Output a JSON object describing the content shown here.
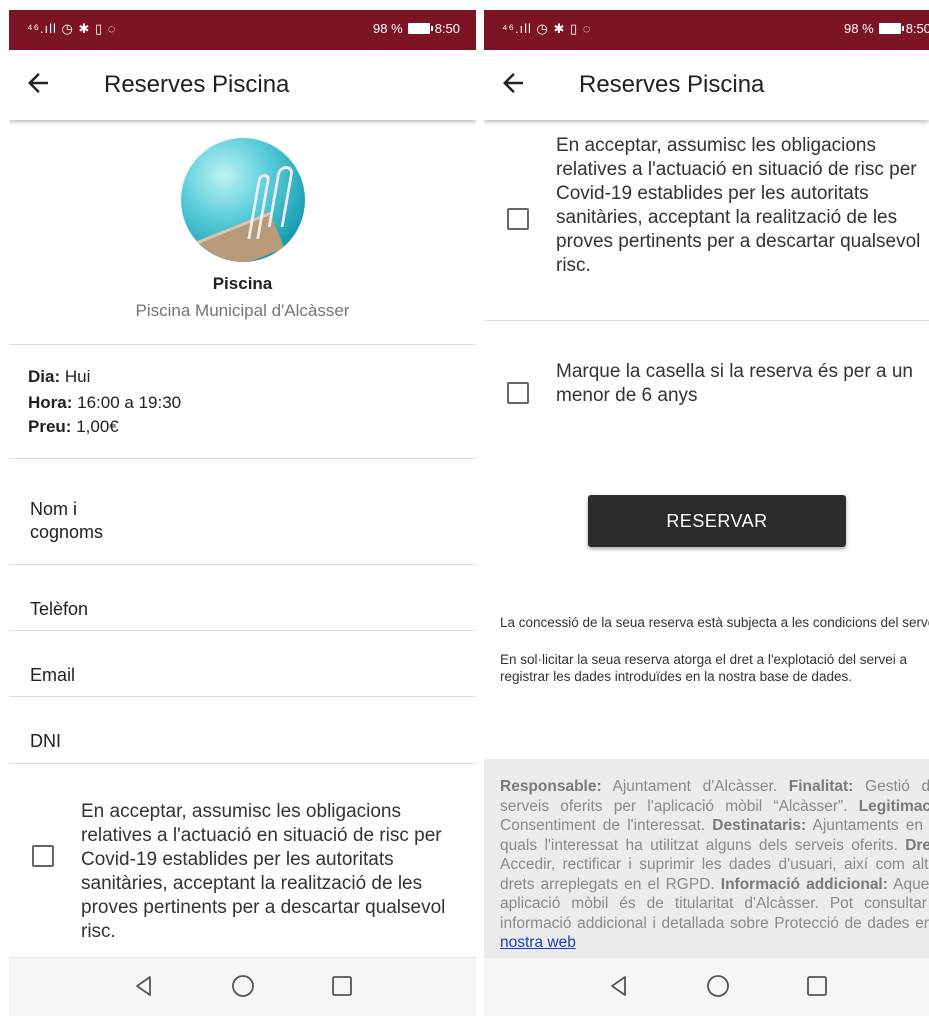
{
  "colors": {
    "status_bar": "#7d1423",
    "button": "#2b2b2b",
    "link": "#1a3fbf"
  },
  "status_bar": {
    "icons_left": "⁴⁶.ıll ◷ ✱ ▯ ◌",
    "battery": "98 %",
    "time": "8:50"
  },
  "app_bar": {
    "back_icon": "arrow-left-icon",
    "title": "Reserves Piscina"
  },
  "left_screen": {
    "facility": {
      "title": "Piscina",
      "subtitle": "Piscina Municipal d'Alcàsser"
    },
    "info": {
      "day_label": "Dia:",
      "day_value": "Hui",
      "hour_label": "Hora:",
      "hour_value": "16:00 a 19:30",
      "price_label": "Preu:",
      "price_value": "1,00€"
    },
    "fields": {
      "name_line1": "Nom i",
      "name_line2": "cognoms",
      "phone": "Telèfon",
      "email": "Email",
      "dni": "DNI"
    },
    "consent_covid": "En acceptar, assumisc les obligacions relatives a l'actuació en situació de risc per Covid-19 establides per les autoritats sanitàries, acceptant la realització de les proves pertinents per a descartar qualsevol risc."
  },
  "right_screen": {
    "consent_covid": "En acceptar, assumisc les obligacions relatives a l'actuació en situació de risc per Covid-19 establides per les autoritats sanitàries, acceptant la realització de les proves pertinents per a descartar qualsevol risc.",
    "consent_minor": "Marque la casella si la reserva és per a un menor de 6 anys",
    "reserve_button": "RESERVAR",
    "note_conditions": "La concessió de la seua reserva està subjecta a les condicions del servei.",
    "note_data": "En sol·licitar la seua reserva atorga el dret a l'explotació del servei a registrar les dades introduïdes en la nostra base de dades.",
    "legal": {
      "responsable_label": "Responsable:",
      "responsable_text": " Ajuntament d'Alcàsser. ",
      "finalitat_label": "Finalitat:",
      "finalitat_text": " Gestió dels serveis oferits per l'aplicació mòbil “Alcàsser”. ",
      "legitimacio_label": "Legitimació:",
      "legitimacio_text": " Consentiment de l'interessat. ",
      "destinataris_label": "Destinataris:",
      "destinataris_text": " Ajuntaments en els quals l'interessat ha utilitzat alguns dels serveis oferits. ",
      "drets_label": "Drets:",
      "drets_text": " Accedir, rectificar i suprimir les dades d'usuari, així com altres drets arreplegats en el RGPD. ",
      "info_label": "Informació addicional:",
      "info_text": " Aquesta aplicació mòbil és de titularitat d'Alcàsser. Pot consultar la informació addicional i detallada sobre Protecció de dades en ",
      "link_text": "la nostra web"
    }
  },
  "nav_bar": {
    "back": "nav-back-icon",
    "home": "nav-home-icon",
    "recents": "nav-recents-icon"
  }
}
